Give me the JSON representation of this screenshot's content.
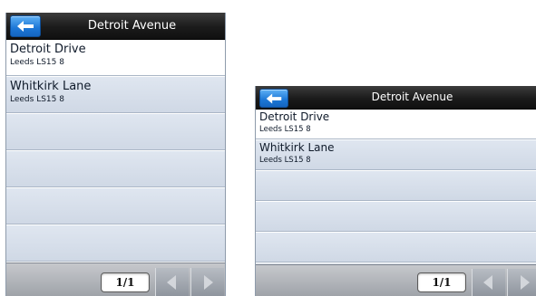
{
  "header": {
    "title": "Detroit Avenue"
  },
  "icons": {
    "back": "back-arrow-icon",
    "previous": "chevron-left-icon",
    "next": "chevron-right-icon"
  },
  "colors": {
    "header_bg": "#1b1b1b",
    "back_button": "#1c77d6",
    "list_row": "#d7dde6",
    "selected_row": "#ffffff",
    "footer_bg": "#b0b4ba"
  },
  "results": [
    {
      "name": "Detroit Drive",
      "sub": "Leeds LS15 8"
    },
    {
      "name": "Whitkirk Lane",
      "sub": "Leeds LS15 8"
    }
  ],
  "pagination": {
    "label": "1/1"
  }
}
